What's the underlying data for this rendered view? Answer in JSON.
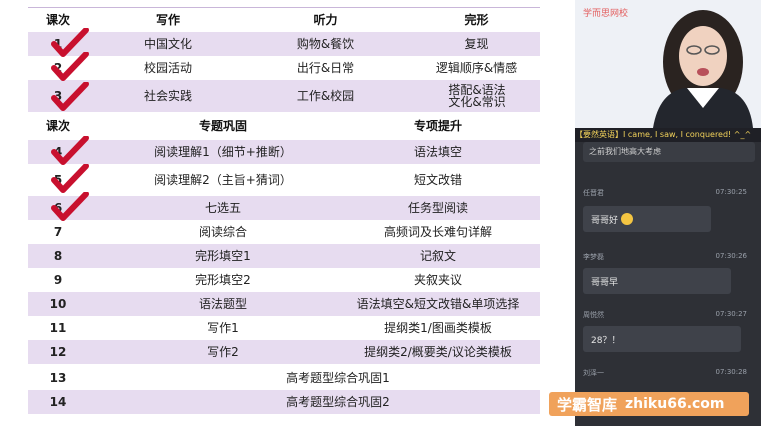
{
  "table": {
    "header1": [
      "课次",
      "写作",
      "听力",
      "完形"
    ],
    "rows1": [
      {
        "num": "1",
        "c1": "中国文化",
        "c2": "购物&餐饮",
        "c3": "复现",
        "checked": true
      },
      {
        "num": "2",
        "c1": "校园活动",
        "c2": "出行&日常",
        "c3": "逻辑顺序&情感",
        "checked": true
      },
      {
        "num": "3",
        "c1": "社会实践",
        "c2": "工作&校园",
        "c3": "搭配&语法文化&常识",
        "checked": true
      }
    ],
    "header2": [
      "课次",
      "专题巩固",
      "专项提升"
    ],
    "rows2": [
      {
        "num": "4",
        "c1": "阅读理解1（细节+推断）",
        "c2": "语法填空",
        "checked": true
      },
      {
        "num": "5",
        "c1": "阅读理解2（主旨+猜词）",
        "c2": "短文改错",
        "checked": true
      },
      {
        "num": "6",
        "c1": "七选五",
        "c2": "任务型阅读",
        "checked": true
      },
      {
        "num": "7",
        "c1": "阅读综合",
        "c2": "高频词及长难句详解",
        "checked": false
      },
      {
        "num": "8",
        "c1": "完形填空1",
        "c2": "记叙文",
        "checked": false
      },
      {
        "num": "9",
        "c1": "完形填空2",
        "c2": "夹叙夹议",
        "checked": false
      },
      {
        "num": "10",
        "c1": "语法题型",
        "c2": "语法填空&短文改错&单项选择",
        "checked": false
      },
      {
        "num": "11",
        "c1": "写作1",
        "c2": "提纲类1/图画类模板",
        "checked": false
      },
      {
        "num": "12",
        "c1": "写作2",
        "c2": "提纲类2/概要类/议论类模板",
        "checked": false
      },
      {
        "num": "13",
        "c1": "高考题型综合巩固1",
        "checked": false
      },
      {
        "num": "14",
        "c1": "高考题型综合巩固2",
        "checked": false
      }
    ]
  },
  "video": {
    "brand": "学而思网校"
  },
  "banner": {
    "tag": "【要然英语】",
    "text": "I came, I saw, I conquered!  ^_^"
  },
  "chat": {
    "top_text": "之前我们地高大考虑",
    "messages": [
      {
        "name": "任晋君",
        "time": "07:30:25",
        "text": "哥哥好"
      },
      {
        "name": "李梦磊",
        "time": "07:30:26",
        "text": "哥哥早"
      },
      {
        "name": "周悦然",
        "time": "07:30:27",
        "text": "28？！"
      },
      {
        "name": "刘泽一",
        "time": "07:30:28",
        "text": ""
      }
    ]
  },
  "watermark": {
    "cn": "学霸智库",
    "url": "zhiku66.com"
  },
  "colors": {
    "lavender": "#e7dcf0",
    "check_red": "#c8102e",
    "banner_yellow": "#f3d35b",
    "watermark_orange": "#f0a25b"
  }
}
